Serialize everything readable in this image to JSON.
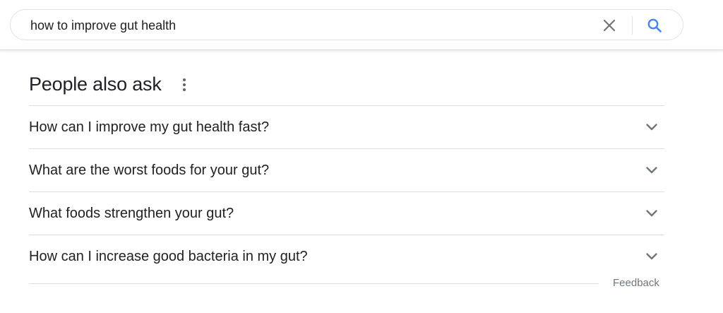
{
  "search": {
    "query": "how to improve gut health",
    "clear_icon": "close-icon",
    "search_icon": "search-icon"
  },
  "people_also_ask": {
    "title": "People also ask",
    "more_icon": "more-vert-icon",
    "questions": [
      {
        "text": "How can I improve my gut health fast?",
        "icon": "chevron-down-icon"
      },
      {
        "text": "What are the worst foods for your gut?",
        "icon": "chevron-down-icon"
      },
      {
        "text": "What foods strengthen your gut?",
        "icon": "chevron-down-icon"
      },
      {
        "text": "How can I increase good bacteria in my gut?",
        "icon": "chevron-down-icon"
      }
    ],
    "feedback_label": "Feedback"
  },
  "colors": {
    "text": "#202124",
    "secondary_text": "#70757a",
    "divider": "#dadce0",
    "search_icon_blue": "#4285f4",
    "icon_gray": "#70757a"
  }
}
